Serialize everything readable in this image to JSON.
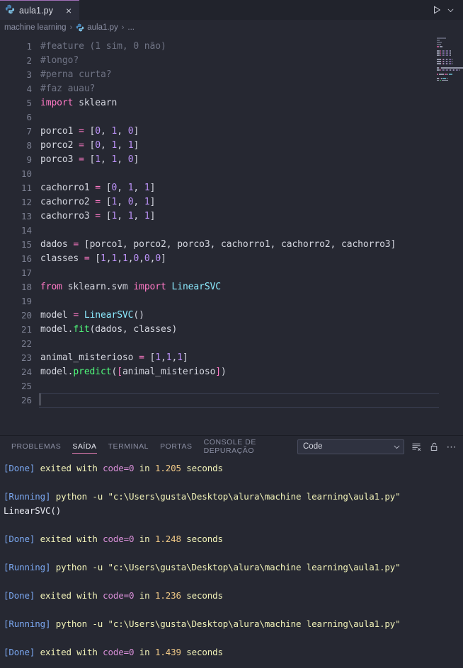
{
  "window": {
    "tab": {
      "label": "aula1.py",
      "icon": "python-icon",
      "close": "×"
    },
    "run_button": "run-icon",
    "run_dropdown": "chevron-down-icon"
  },
  "breadcrumb": {
    "folder": "machine learning",
    "sep": "›",
    "file": "aula1.py",
    "ellipsis": "..."
  },
  "editor": {
    "lines": [
      {
        "n": "1",
        "tokens": [
          {
            "t": "com",
            "v": "#feature (1 sim, 0 não)"
          }
        ]
      },
      {
        "n": "2",
        "tokens": [
          {
            "t": "com",
            "v": "#longo?"
          }
        ]
      },
      {
        "n": "3",
        "tokens": [
          {
            "t": "com",
            "v": "#perna curta?"
          }
        ]
      },
      {
        "n": "4",
        "tokens": [
          {
            "t": "com",
            "v": "#faz auau?"
          }
        ]
      },
      {
        "n": "5",
        "tokens": [
          {
            "t": "kw",
            "v": "import"
          },
          {
            "t": "pl",
            "v": " sklearn"
          }
        ]
      },
      {
        "n": "6",
        "tokens": []
      },
      {
        "n": "7",
        "tokens": [
          {
            "t": "pl",
            "v": "porco1 "
          },
          {
            "t": "op",
            "v": "="
          },
          {
            "t": "pl",
            "v": " ["
          },
          {
            "t": "num",
            "v": "0"
          },
          {
            "t": "pl",
            "v": ", "
          },
          {
            "t": "num",
            "v": "1"
          },
          {
            "t": "pl",
            "v": ", "
          },
          {
            "t": "num",
            "v": "0"
          },
          {
            "t": "pl",
            "v": "]"
          }
        ]
      },
      {
        "n": "8",
        "tokens": [
          {
            "t": "pl",
            "v": "porco2 "
          },
          {
            "t": "op",
            "v": "="
          },
          {
            "t": "pl",
            "v": " ["
          },
          {
            "t": "num",
            "v": "0"
          },
          {
            "t": "pl",
            "v": ", "
          },
          {
            "t": "num",
            "v": "1"
          },
          {
            "t": "pl",
            "v": ", "
          },
          {
            "t": "num",
            "v": "1"
          },
          {
            "t": "pl",
            "v": "]"
          }
        ]
      },
      {
        "n": "9",
        "tokens": [
          {
            "t": "pl",
            "v": "porco3 "
          },
          {
            "t": "op",
            "v": "="
          },
          {
            "t": "pl",
            "v": " ["
          },
          {
            "t": "num",
            "v": "1"
          },
          {
            "t": "pl",
            "v": ", "
          },
          {
            "t": "num",
            "v": "1"
          },
          {
            "t": "pl",
            "v": ", "
          },
          {
            "t": "num",
            "v": "0"
          },
          {
            "t": "pl",
            "v": "]"
          }
        ]
      },
      {
        "n": "10",
        "tokens": []
      },
      {
        "n": "11",
        "tokens": [
          {
            "t": "pl",
            "v": "cachorro1 "
          },
          {
            "t": "op",
            "v": "="
          },
          {
            "t": "pl",
            "v": " ["
          },
          {
            "t": "num",
            "v": "0"
          },
          {
            "t": "pl",
            "v": ", "
          },
          {
            "t": "num",
            "v": "1"
          },
          {
            "t": "pl",
            "v": ", "
          },
          {
            "t": "num",
            "v": "1"
          },
          {
            "t": "pl",
            "v": "]"
          }
        ]
      },
      {
        "n": "12",
        "tokens": [
          {
            "t": "pl",
            "v": "cachorro2 "
          },
          {
            "t": "op",
            "v": "="
          },
          {
            "t": "pl",
            "v": " ["
          },
          {
            "t": "num",
            "v": "1"
          },
          {
            "t": "pl",
            "v": ", "
          },
          {
            "t": "num",
            "v": "0"
          },
          {
            "t": "pl",
            "v": ", "
          },
          {
            "t": "num",
            "v": "1"
          },
          {
            "t": "pl",
            "v": "]"
          }
        ]
      },
      {
        "n": "13",
        "tokens": [
          {
            "t": "pl",
            "v": "cachorro3 "
          },
          {
            "t": "op",
            "v": "="
          },
          {
            "t": "pl",
            "v": " ["
          },
          {
            "t": "num",
            "v": "1"
          },
          {
            "t": "pl",
            "v": ", "
          },
          {
            "t": "num",
            "v": "1"
          },
          {
            "t": "pl",
            "v": ", "
          },
          {
            "t": "num",
            "v": "1"
          },
          {
            "t": "pl",
            "v": "]"
          }
        ]
      },
      {
        "n": "14",
        "tokens": []
      },
      {
        "n": "15",
        "tokens": [
          {
            "t": "pl",
            "v": "dados "
          },
          {
            "t": "op",
            "v": "="
          },
          {
            "t": "pl",
            "v": " [porco1, porco2, porco3, cachorro1, cachorro2, cachorro3]"
          }
        ]
      },
      {
        "n": "16",
        "tokens": [
          {
            "t": "pl",
            "v": "classes "
          },
          {
            "t": "op",
            "v": "="
          },
          {
            "t": "pl",
            "v": " ["
          },
          {
            "t": "num",
            "v": "1"
          },
          {
            "t": "pl",
            "v": ","
          },
          {
            "t": "num",
            "v": "1"
          },
          {
            "t": "pl",
            "v": ","
          },
          {
            "t": "num",
            "v": "1"
          },
          {
            "t": "pl",
            "v": ","
          },
          {
            "t": "num",
            "v": "0"
          },
          {
            "t": "pl",
            "v": ","
          },
          {
            "t": "num",
            "v": "0"
          },
          {
            "t": "pl",
            "v": ","
          },
          {
            "t": "num",
            "v": "0"
          },
          {
            "t": "pl",
            "v": "]"
          }
        ]
      },
      {
        "n": "17",
        "tokens": []
      },
      {
        "n": "18",
        "tokens": [
          {
            "t": "kw",
            "v": "from"
          },
          {
            "t": "pl",
            "v": " sklearn.svm "
          },
          {
            "t": "kw",
            "v": "import"
          },
          {
            "t": "pl",
            "v": " "
          },
          {
            "t": "cls",
            "v": "LinearSVC"
          }
        ]
      },
      {
        "n": "19",
        "tokens": []
      },
      {
        "n": "20",
        "tokens": [
          {
            "t": "pl",
            "v": "model "
          },
          {
            "t": "op",
            "v": "="
          },
          {
            "t": "pl",
            "v": " "
          },
          {
            "t": "cls",
            "v": "LinearSVC"
          },
          {
            "t": "pl",
            "v": "()"
          }
        ]
      },
      {
        "n": "21",
        "tokens": [
          {
            "t": "pl",
            "v": "model."
          },
          {
            "t": "fn",
            "v": "fit"
          },
          {
            "t": "pl",
            "v": "(dados, classes)"
          }
        ]
      },
      {
        "n": "22",
        "tokens": []
      },
      {
        "n": "23",
        "tokens": [
          {
            "t": "pl",
            "v": "animal_misterioso "
          },
          {
            "t": "op",
            "v": "="
          },
          {
            "t": "pl",
            "v": " ["
          },
          {
            "t": "num",
            "v": "1"
          },
          {
            "t": "pl",
            "v": ","
          },
          {
            "t": "num",
            "v": "1"
          },
          {
            "t": "pl",
            "v": ","
          },
          {
            "t": "num",
            "v": "1"
          },
          {
            "t": "pl",
            "v": "]"
          }
        ]
      },
      {
        "n": "24",
        "tokens": [
          {
            "t": "pl",
            "v": "model."
          },
          {
            "t": "fn",
            "v": "predict"
          },
          {
            "t": "pl",
            "v": "("
          },
          {
            "t": "brp",
            "v": "["
          },
          {
            "t": "pl",
            "v": "animal_misterioso"
          },
          {
            "t": "brp",
            "v": "]"
          },
          {
            "t": "pl",
            "v": ")"
          }
        ]
      },
      {
        "n": "25",
        "tokens": []
      },
      {
        "n": "26",
        "tokens": [],
        "current": true,
        "caret": true
      }
    ]
  },
  "panel": {
    "tabs": [
      {
        "label": "PROBLEMAS",
        "active": false
      },
      {
        "label": "SAÍDA",
        "active": true
      },
      {
        "label": "TERMINAL",
        "active": false
      },
      {
        "label": "PORTAS",
        "active": false
      },
      {
        "label": "CONSOLE DE DEPURAÇÃO",
        "active": false
      }
    ],
    "select_value": "Code",
    "select_chevron": "chevron-down-icon",
    "actions": [
      {
        "name": "clear-output-icon"
      },
      {
        "name": "lock-icon"
      },
      {
        "name": "more-actions-icon",
        "glyph": "⋯"
      }
    ],
    "output_lines": [
      {
        "segs": [
          {
            "t": "tag",
            "v": "[Done]"
          },
          {
            "t": "txt",
            "v": " exited with "
          },
          {
            "t": "code",
            "v": "code=0"
          },
          {
            "t": "txt",
            "v": " in "
          },
          {
            "t": "num",
            "v": "1.205"
          },
          {
            "t": "txt",
            "v": " seconds"
          }
        ]
      },
      {
        "segs": []
      },
      {
        "segs": [
          {
            "t": "tag",
            "v": "[Running]"
          },
          {
            "t": "txt",
            "v": " python -u \"c:\\Users\\gusta\\Desktop\\alura\\machine learning\\aula1.py\""
          }
        ]
      },
      {
        "segs": [
          {
            "t": "plain",
            "v": "LinearSVC()"
          }
        ]
      },
      {
        "segs": []
      },
      {
        "segs": [
          {
            "t": "tag",
            "v": "[Done]"
          },
          {
            "t": "txt",
            "v": " exited with "
          },
          {
            "t": "code",
            "v": "code=0"
          },
          {
            "t": "txt",
            "v": " in "
          },
          {
            "t": "num",
            "v": "1.248"
          },
          {
            "t": "txt",
            "v": " seconds"
          }
        ]
      },
      {
        "segs": []
      },
      {
        "segs": [
          {
            "t": "tag",
            "v": "[Running]"
          },
          {
            "t": "txt",
            "v": " python -u \"c:\\Users\\gusta\\Desktop\\alura\\machine learning\\aula1.py\""
          }
        ]
      },
      {
        "segs": []
      },
      {
        "segs": [
          {
            "t": "tag",
            "v": "[Done]"
          },
          {
            "t": "txt",
            "v": " exited with "
          },
          {
            "t": "code",
            "v": "code=0"
          },
          {
            "t": "txt",
            "v": " in "
          },
          {
            "t": "num",
            "v": "1.236"
          },
          {
            "t": "txt",
            "v": " seconds"
          }
        ]
      },
      {
        "segs": []
      },
      {
        "segs": [
          {
            "t": "tag",
            "v": "[Running]"
          },
          {
            "t": "txt",
            "v": " python -u \"c:\\Users\\gusta\\Desktop\\alura\\machine learning\\aula1.py\""
          }
        ]
      },
      {
        "segs": []
      },
      {
        "segs": [
          {
            "t": "tag",
            "v": "[Done]"
          },
          {
            "t": "txt",
            "v": " exited with "
          },
          {
            "t": "code",
            "v": "code=0"
          },
          {
            "t": "txt",
            "v": " in "
          },
          {
            "t": "num",
            "v": "1.439"
          },
          {
            "t": "txt",
            "v": " seconds"
          }
        ]
      }
    ]
  },
  "colors": {
    "editor_bg": "#262832",
    "tabbar_bg": "#21232c",
    "active_tab_bg": "#2b2d3a",
    "accent_tab_top": "#a06fb8",
    "panel_tab_underline": "#e07ab0",
    "keyword": "#ff79c6",
    "number": "#bd93f9",
    "function": "#50fa7b",
    "class": "#8be9fd",
    "comment": "#6f7384",
    "foreground": "#d5d7e0",
    "output_tag": "#7aa7f0",
    "output_text": "#f1f2b8",
    "output_code": "#d98fd8",
    "output_num": "#f0c987"
  }
}
